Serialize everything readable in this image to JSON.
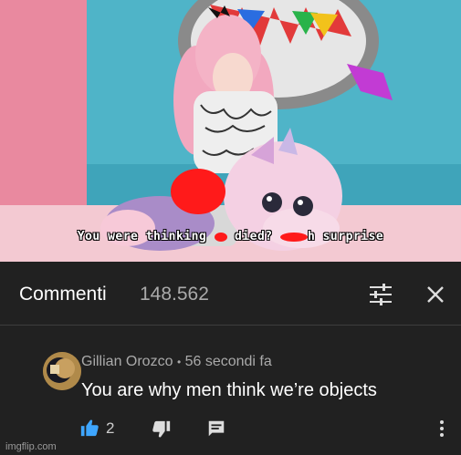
{
  "video": {
    "caption_parts": [
      "You were thinking ",
      " died? ",
      "h surprise"
    ]
  },
  "comments_header": {
    "title": "Commenti",
    "count": "148.562",
    "icons": {
      "filter": "filter-sliders-icon",
      "close": "close-icon"
    }
  },
  "comment": {
    "author": "Gillian Orozco",
    "separator": "•",
    "time": "56 secondi fa",
    "text": "You are why men think we’re objects",
    "like_count": "2",
    "icons": {
      "like": "thumbs-up-icon",
      "dislike": "thumbs-down-icon",
      "reply": "reply-comment-icon",
      "more": "more-vert-icon"
    }
  },
  "watermark": "imgflip.com",
  "colors": {
    "background": "#212121",
    "like_active": "#3ea6ff",
    "redaction": "#ff1a1a"
  }
}
